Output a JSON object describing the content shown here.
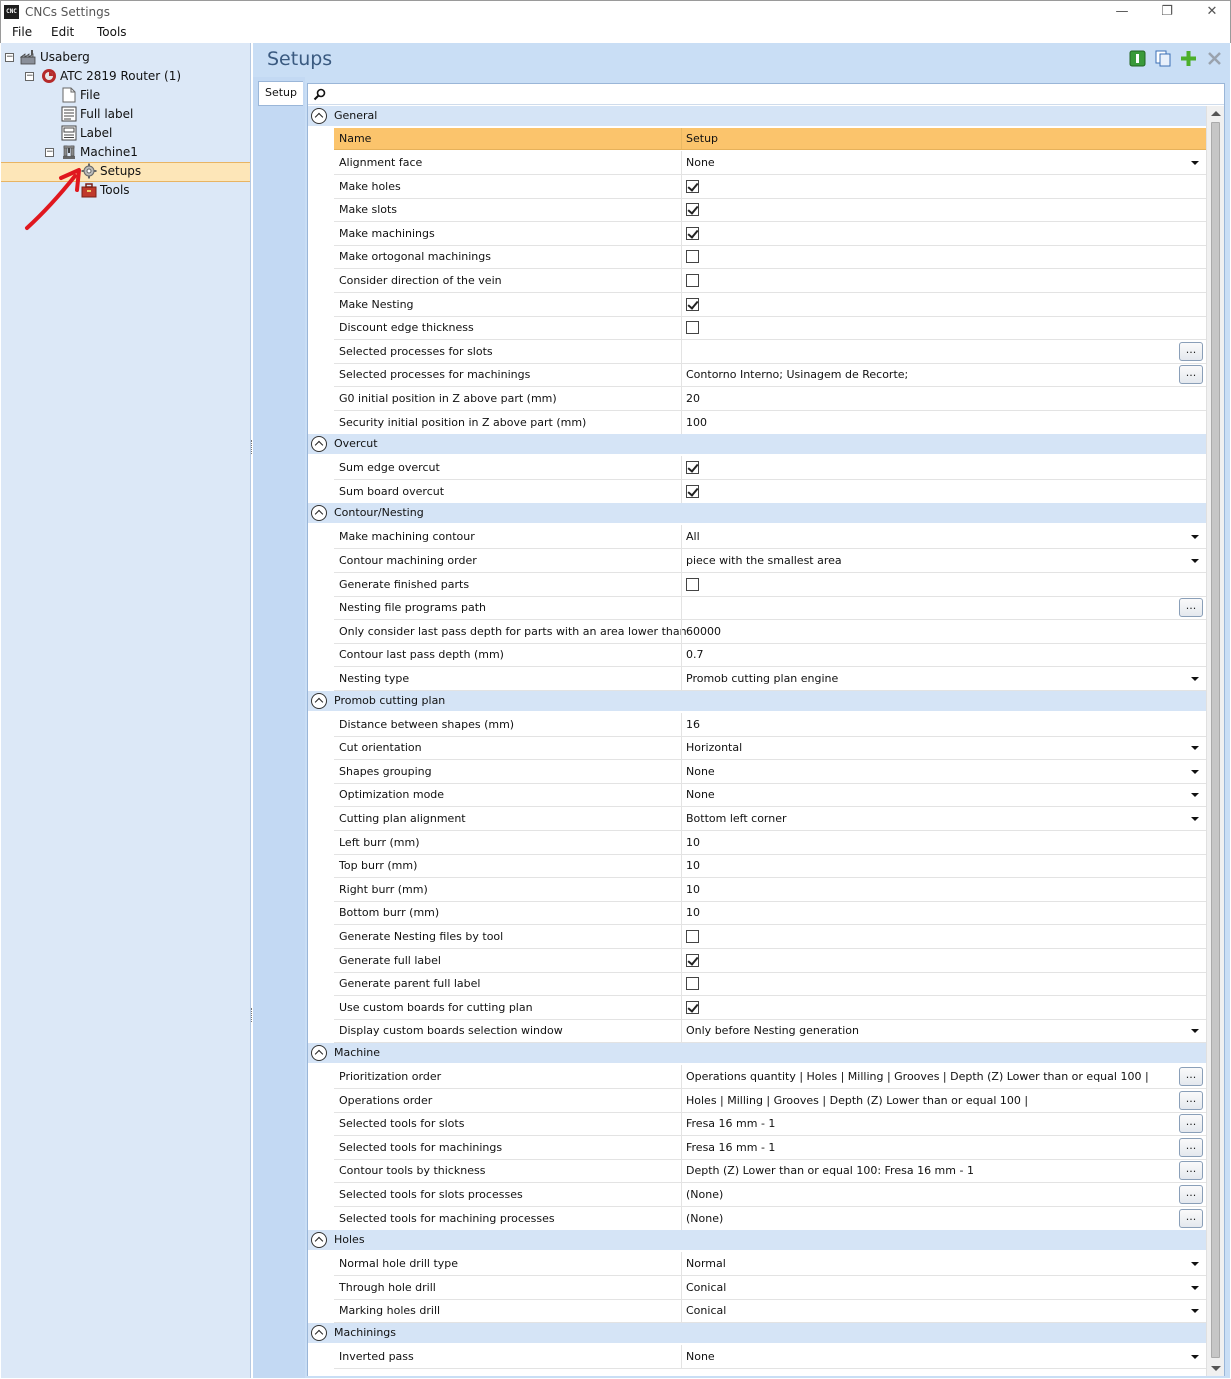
{
  "window": {
    "title": "CNCs Settings",
    "app_icon_text": "CNC",
    "controls": {
      "minimize": "—",
      "restore": "❐",
      "close": "✕"
    }
  },
  "menu": [
    "File",
    "Edit",
    "Tools"
  ],
  "tree": {
    "root": "Usaberg",
    "router": "ATC 2819 Router (1)",
    "file": "File",
    "full_label": "Full label",
    "label": "Label",
    "machine": "Machine1",
    "setups": "Setups",
    "tools": "Tools",
    "expander_symbol": "⊟"
  },
  "main": {
    "title": "Setups",
    "tab": "Setup",
    "search": {
      "value": "",
      "placeholder": ""
    },
    "ellipsis_label": "...",
    "grid_header": {
      "name": "Name",
      "value": "Setup"
    },
    "categories": [
      {
        "label": "General",
        "rows": [
          {
            "name": "Alignment face",
            "type": "dropdown",
            "value": "None"
          },
          {
            "name": "Make holes",
            "type": "checkbox",
            "checked": true
          },
          {
            "name": "Make slots",
            "type": "checkbox",
            "checked": true
          },
          {
            "name": "Make machinings",
            "type": "checkbox",
            "checked": true
          },
          {
            "name": "Make ortogonal machinings",
            "type": "checkbox",
            "checked": false
          },
          {
            "name": "Consider direction of the vein",
            "type": "checkbox",
            "checked": false
          },
          {
            "name": "Make Nesting",
            "type": "checkbox",
            "checked": true
          },
          {
            "name": "Discount edge thickness",
            "type": "checkbox",
            "checked": false
          },
          {
            "name": "Selected processes for slots",
            "type": "ellipsis",
            "value": ""
          },
          {
            "name": "Selected processes for machinings",
            "type": "ellipsis",
            "value": "Contorno Interno; Usinagem de Recorte;"
          },
          {
            "name": "G0 initial position in Z above part (mm)",
            "type": "text",
            "value": "20"
          },
          {
            "name": "Security initial position in Z above part (mm)",
            "type": "text",
            "value": "100"
          }
        ]
      },
      {
        "label": "Overcut",
        "rows": [
          {
            "name": "Sum edge overcut",
            "type": "checkbox",
            "checked": true
          },
          {
            "name": "Sum board overcut",
            "type": "checkbox",
            "checked": true
          }
        ]
      },
      {
        "label": "Contour/Nesting",
        "rows": [
          {
            "name": "Make machining contour",
            "type": "dropdown",
            "value": "All"
          },
          {
            "name": "Contour machining order",
            "type": "dropdown",
            "value": "piece with the smallest area"
          },
          {
            "name": "Generate finished parts",
            "type": "checkbox",
            "checked": false
          },
          {
            "name": "Nesting file programs path",
            "type": "ellipsis",
            "value": ""
          },
          {
            "name": "Only consider last pass depth for parts with an area lower than",
            "type": "text",
            "value": "60000"
          },
          {
            "name": "Contour last pass depth (mm)",
            "type": "text",
            "value": "0.7"
          },
          {
            "name": "Nesting type",
            "type": "dropdown",
            "value": "Promob cutting plan engine"
          }
        ]
      },
      {
        "label": "Promob cutting plan",
        "rows": [
          {
            "name": "Distance between shapes (mm)",
            "type": "text",
            "value": "16"
          },
          {
            "name": "Cut orientation",
            "type": "dropdown",
            "value": "Horizontal"
          },
          {
            "name": "Shapes grouping",
            "type": "dropdown",
            "value": "None"
          },
          {
            "name": "Optimization mode",
            "type": "dropdown",
            "value": "None"
          },
          {
            "name": "Cutting plan alignment",
            "type": "dropdown",
            "value": "Bottom left corner"
          },
          {
            "name": "Left burr (mm)",
            "type": "text",
            "value": "10"
          },
          {
            "name": "Top burr (mm)",
            "type": "text",
            "value": "10"
          },
          {
            "name": "Right burr (mm)",
            "type": "text",
            "value": "10"
          },
          {
            "name": "Bottom burr (mm)",
            "type": "text",
            "value": "10"
          },
          {
            "name": "Generate Nesting files by tool",
            "type": "checkbox",
            "checked": false
          },
          {
            "name": "Generate full label",
            "type": "checkbox",
            "checked": true
          },
          {
            "name": "Generate parent full label",
            "type": "checkbox",
            "checked": false
          },
          {
            "name": "Use custom boards for cutting plan",
            "type": "checkbox",
            "checked": true
          },
          {
            "name": "Display custom boards selection window",
            "type": "dropdown",
            "value": "Only before Nesting generation"
          }
        ]
      },
      {
        "label": "Machine",
        "rows": [
          {
            "name": "Prioritization order",
            "type": "ellipsis",
            "value": "Operations quantity | Holes | Milling | Grooves | Depth (Z) Lower than or equal 100 |"
          },
          {
            "name": "Operations order",
            "type": "ellipsis",
            "value": "Holes | Milling | Grooves | Depth (Z) Lower than or equal 100 |"
          },
          {
            "name": "Selected tools for slots",
            "type": "ellipsis",
            "value": "Fresa 16 mm - 1"
          },
          {
            "name": "Selected tools for machinings",
            "type": "ellipsis",
            "value": "Fresa 16 mm - 1"
          },
          {
            "name": "Contour tools by thickness",
            "type": "ellipsis",
            "value": "Depth (Z) Lower than or equal 100: Fresa 16 mm - 1"
          },
          {
            "name": "Selected tools for slots processes",
            "type": "ellipsis",
            "value": "(None)"
          },
          {
            "name": "Selected tools for machining processes",
            "type": "ellipsis",
            "value": "(None)"
          }
        ]
      },
      {
        "label": "Holes",
        "rows": [
          {
            "name": "Normal hole drill type",
            "type": "dropdown",
            "value": "Normal"
          },
          {
            "name": "Through hole drill",
            "type": "dropdown",
            "value": "Conical"
          },
          {
            "name": "Marking holes drill",
            "type": "dropdown",
            "value": "Conical"
          }
        ]
      },
      {
        "label": "Machinings",
        "rows": [
          {
            "name": "Inverted pass",
            "type": "dropdown",
            "value": "None"
          }
        ]
      }
    ]
  },
  "colors": {
    "tree_bg": "#dce8f7",
    "selected_bg": "#fde6b8",
    "grid_header_bg": "#fbc46c",
    "category_bg": "#d5e4f6",
    "title_color": "#3a5a80",
    "annotation_arrow": "#e0171e"
  }
}
